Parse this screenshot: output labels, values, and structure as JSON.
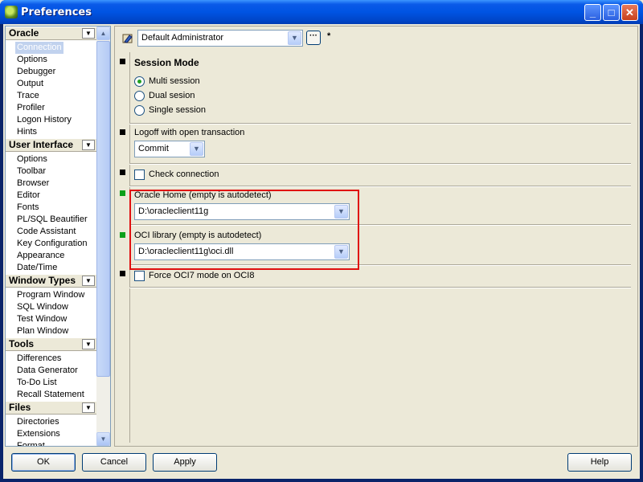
{
  "window": {
    "title": "Preferences",
    "minimize_label": "_",
    "maximize_label": "□",
    "close_label": "✕"
  },
  "sidebar": {
    "groups": [
      {
        "label": "Oracle",
        "items": [
          "Connection",
          "Options",
          "Debugger",
          "Output",
          "Trace",
          "Profiler",
          "Logon History",
          "Hints"
        ]
      },
      {
        "label": "User Interface",
        "items": [
          "Options",
          "Toolbar",
          "Browser",
          "Editor",
          "Fonts",
          "PL/SQL Beautifier",
          "Code Assistant",
          "Key Configuration",
          "Appearance",
          "Date/Time"
        ]
      },
      {
        "label": "Window Types",
        "items": [
          "Program Window",
          "SQL Window",
          "Test Window",
          "Plan Window"
        ]
      },
      {
        "label": "Tools",
        "items": [
          "Differences",
          "Data Generator",
          "To-Do List",
          "Recall Statement"
        ]
      },
      {
        "label": "Files",
        "items": [
          "Directories",
          "Extensions",
          "Format"
        ]
      }
    ],
    "selected_item": "Connection"
  },
  "profile": {
    "value": "Default Administrator",
    "more_label": "···",
    "modified_marker": "*"
  },
  "session_mode": {
    "heading": "Session Mode",
    "options": [
      "Multi session",
      "Dual sesion",
      "Single session"
    ],
    "selected": "Multi session"
  },
  "logoff": {
    "label": "Logoff with open transaction",
    "value": "Commit"
  },
  "check_connection": {
    "label": "Check connection",
    "checked": false
  },
  "oracle_home": {
    "label": "Oracle Home (empty is autodetect)",
    "value": "D:\\oracleclient11g"
  },
  "oci_library": {
    "label": "OCI library (empty is autodetect)",
    "value": "D:\\oracleclient11g\\oci.dll"
  },
  "force_oci7": {
    "label": "Force OCI7 mode on OCI8",
    "checked": false
  },
  "buttons": {
    "ok": "OK",
    "cancel": "Cancel",
    "apply": "Apply",
    "help": "Help"
  },
  "colors": {
    "titlebar": "#0054e3",
    "highlight": "#e01010",
    "radio_dot": "#21a121"
  }
}
